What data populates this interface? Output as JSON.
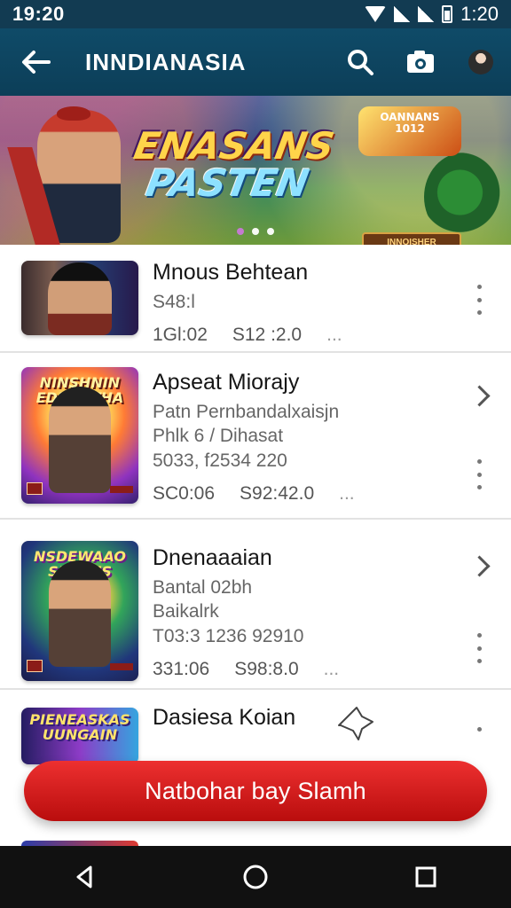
{
  "status": {
    "time_left": "19:20",
    "time_right": "1:20"
  },
  "appbar": {
    "title": "INNDIANASIA"
  },
  "banner": {
    "title_line1": "ENASANS",
    "title_line2": "PASTEN",
    "badge_text": "OANNANS",
    "badge_sub": "1012",
    "sign_text": "INNOISHER ENTRADE"
  },
  "list": {
    "items": [
      {
        "name": "Mnous Behtean",
        "lines": [
          "S48:l"
        ],
        "price_left": "1Gl:02",
        "price_right": "S12 :2.0",
        "suffix": "...",
        "thumb_title": ""
      },
      {
        "name": "Apseat Miorajy",
        "lines": [
          "Patn Pernbandalxaisjn",
          "Phlk 6 / Dihasat",
          "5033, f2534 220"
        ],
        "price_left": "SC0:06",
        "price_right": "S92:42.0",
        "suffix": "...",
        "thumb_title": "NINSHNIN\nEDDENTHA"
      },
      {
        "name": "Dnenaaaian",
        "lines": [
          "Bantal 02bh",
          "Baikalrk",
          "T03:3 1236 92910"
        ],
        "price_left": "331:06",
        "price_right": "S98:8.0",
        "suffix": "...",
        "thumb_title": "NSDEWAAO\nSUJSAIS"
      },
      {
        "name": "Dasiesa Koian",
        "lines": [],
        "price_left": "",
        "price_right": "",
        "suffix": "",
        "thumb_title": "PIENEASKAS\nUUNGAIN"
      }
    ]
  },
  "cta": {
    "label": "Natbohar bay Slamh"
  },
  "theme": {
    "primary": "#0f4b68",
    "accent": "#e02323",
    "status_bar": "#123b52"
  }
}
